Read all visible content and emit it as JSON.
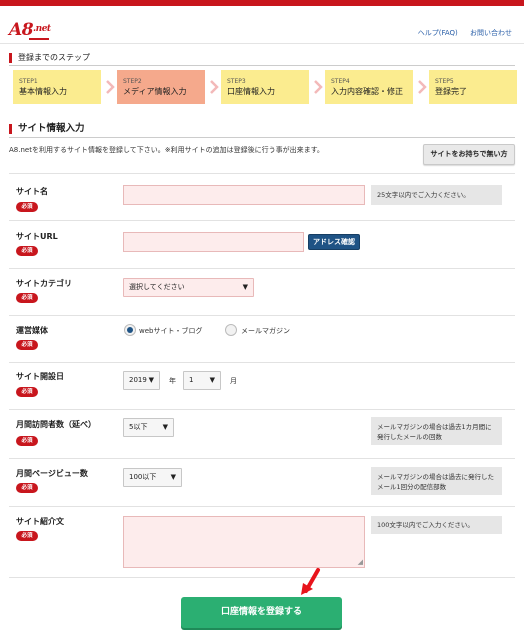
{
  "header": {
    "logo": "A8.net",
    "links": [
      "ヘルプ(FAQ)",
      "お問い合わせ"
    ]
  },
  "steps_section": {
    "title": "登録までのステップ",
    "steps": [
      {
        "num": "STEP1",
        "label": "基本情報入力",
        "active": false
      },
      {
        "num": "STEP2",
        "label": "メディア情報入力",
        "active": true
      },
      {
        "num": "STEP3",
        "label": "口座情報入力",
        "active": false
      },
      {
        "num": "STEP4",
        "label": "入力内容確認・修正",
        "active": false
      },
      {
        "num": "STEP5",
        "label": "登録完了",
        "active": false
      }
    ]
  },
  "site_section": {
    "title": "サイト情報入力",
    "description": "A8.netを利用するサイト情報を登録して下さい。※利用サイトの追加は登録後に行う事が出来ます。",
    "later_button": "サイトをお持ちで無い方"
  },
  "required_badge": "必須",
  "fields": {
    "site_name": {
      "label": "サイト名",
      "value": "",
      "hint": "25文字以内でご入力ください。"
    },
    "site_url": {
      "label": "サイトURL",
      "value": "",
      "button": "アドレス確認"
    },
    "site_category": {
      "label": "サイトカテゴリ",
      "selected": "選択してください"
    },
    "media_type": {
      "label": "運営媒体",
      "options": [
        "webサイト・ブログ",
        "メールマガジン"
      ],
      "selected": "webサイト・ブログ"
    },
    "open_date": {
      "label": "サイト開設日",
      "year": "2019",
      "year_unit": "年",
      "month": "1",
      "month_unit": "月"
    },
    "monthly_visitors": {
      "label": "月間訪問者数（延べ）",
      "selected": "5以下",
      "hint": "メールマガジンの場合は過去1カ月間に発行したメールの回数"
    },
    "monthly_pageviews": {
      "label": "月間ページビュー数",
      "selected": "100以下",
      "hint": "メールマガジンの場合は過去に発行したメール1回分の配信部数"
    },
    "site_intro": {
      "label": "サイト紹介文",
      "value": "",
      "hint": "100文字以内でご入力ください。"
    }
  },
  "submit_button": "口座情報を登録する",
  "colors": {
    "brand": "#c8161d",
    "step": "#fbec8f",
    "step_active": "#f5a98c",
    "submit": "#2baf72",
    "address_button": "#1f5385"
  }
}
